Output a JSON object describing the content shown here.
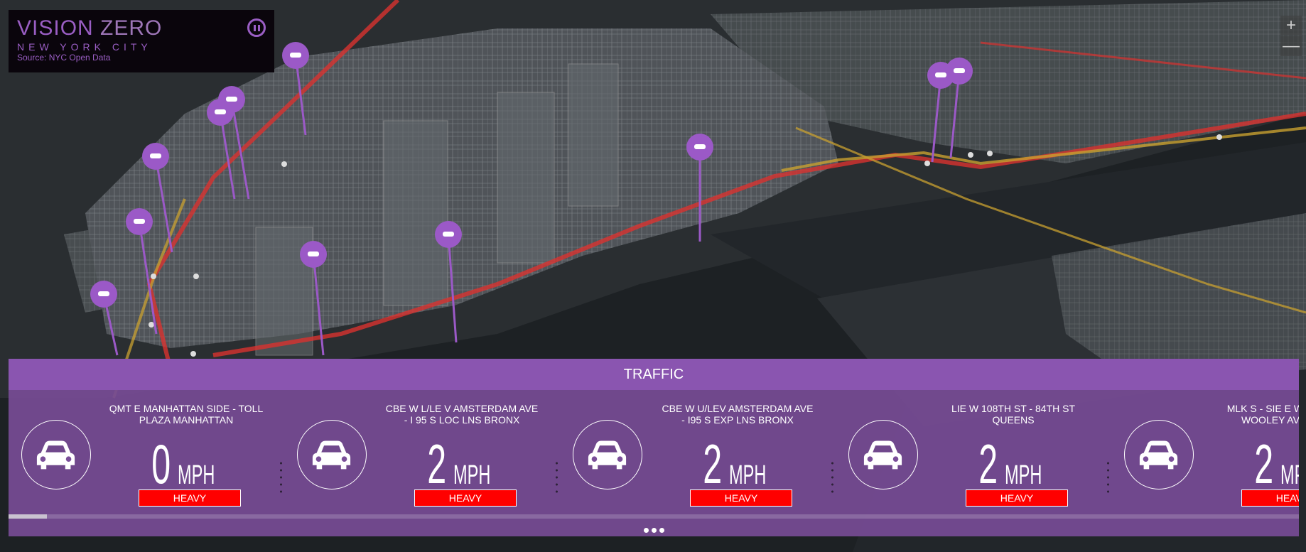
{
  "header": {
    "title_bold": "VISION",
    "title_thin": "ZERO",
    "subtitle": "NEW YORK CITY",
    "source": "Source: NYC Open Data",
    "pause_icon": "pause-icon"
  },
  "map_controls": {
    "zoom_in": "+",
    "zoom_out": "—"
  },
  "map": {
    "pin_icon": "car-icon",
    "pin_color": "#9b59c7"
  },
  "traffic": {
    "title": "TRAFFIC",
    "speed_unit": "MPH",
    "status_color": "#ff0000",
    "cards": [
      {
        "name": "QMT E MANHATTAN SIDE - TOLL PLAZA MANHATTAN",
        "speed": "0",
        "status": "HEAVY"
      },
      {
        "name": "CBE W L/LE V AMSTERDAM AVE - I 95 S LOC LNS BRONX",
        "speed": "2",
        "status": "HEAVY"
      },
      {
        "name": "CBE W U/LEV AMSTERDAM AVE - I95 S EXP LNS BRONX",
        "speed": "2",
        "status": "HEAVY"
      },
      {
        "name": "LIE W 108TH ST - 84TH ST QUEENS",
        "speed": "2",
        "status": "HEAVY"
      },
      {
        "name": "MLK S - SIE E WALKER ST WOOLEY AVENUE S",
        "speed": "2",
        "status": "HEAVY"
      }
    ],
    "progress": 0.03,
    "page_dots": 3
  }
}
